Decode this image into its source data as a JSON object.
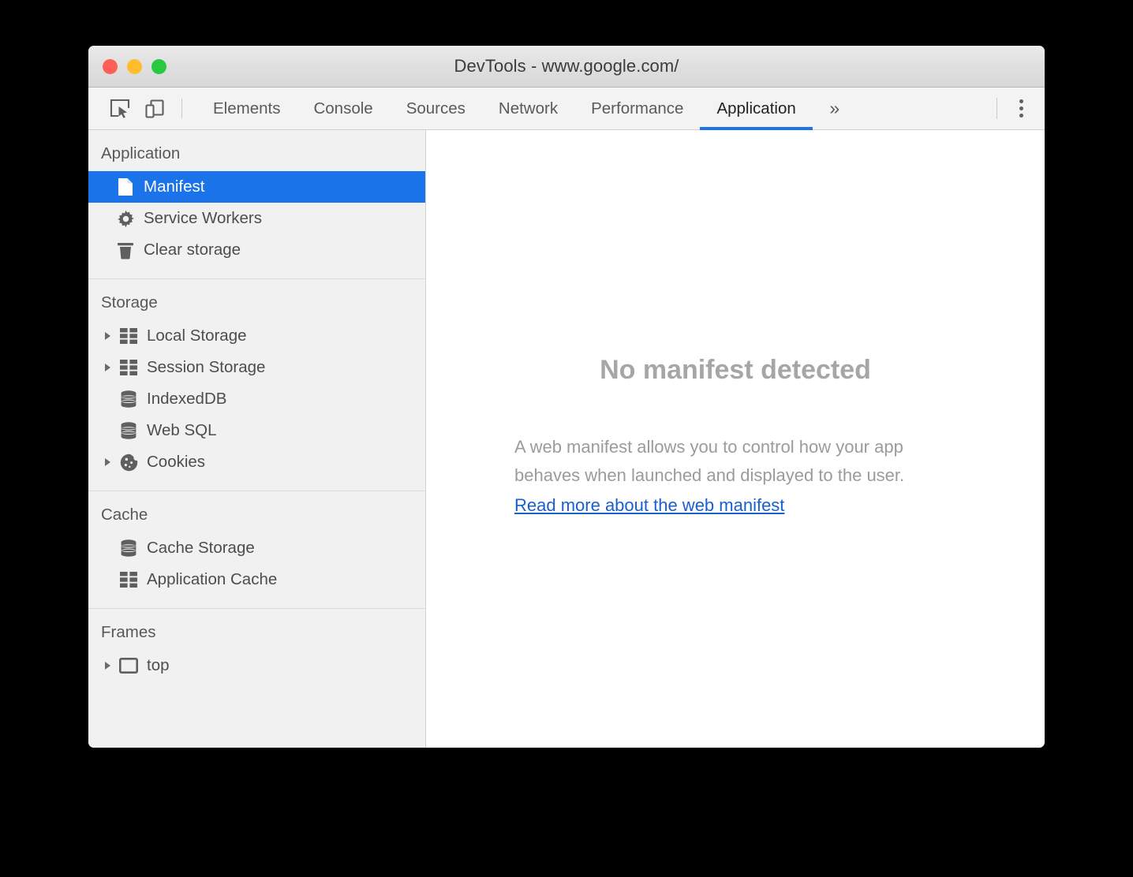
{
  "window": {
    "title": "DevTools - www.google.com/",
    "traffic_lights": [
      {
        "name": "close",
        "color": "#ff5f56"
      },
      {
        "name": "minimize",
        "color": "#ffbd2e"
      },
      {
        "name": "maximize",
        "color": "#27c93f"
      }
    ]
  },
  "toolbar": {
    "inspect_icon": "inspect-element-icon",
    "device_icon": "device-toolbar-icon",
    "overflow_label": "»",
    "menu_icon": "more-vertical-icon",
    "tabs": [
      {
        "label": "Elements",
        "active": false
      },
      {
        "label": "Console",
        "active": false
      },
      {
        "label": "Sources",
        "active": false
      },
      {
        "label": "Network",
        "active": false
      },
      {
        "label": "Performance",
        "active": false
      },
      {
        "label": "Application",
        "active": true
      }
    ],
    "active_tab": "Application",
    "accent_color": "#1a73e8"
  },
  "sidebar": {
    "sections": [
      {
        "title": "Application",
        "items": [
          {
            "label": "Manifest",
            "icon": "document-icon",
            "expandable": false,
            "selected": true
          },
          {
            "label": "Service Workers",
            "icon": "gear-icon",
            "expandable": false,
            "selected": false
          },
          {
            "label": "Clear storage",
            "icon": "trash-icon",
            "expandable": false,
            "selected": false
          }
        ]
      },
      {
        "title": "Storage",
        "items": [
          {
            "label": "Local Storage",
            "icon": "table-icon",
            "expandable": true,
            "selected": false
          },
          {
            "label": "Session Storage",
            "icon": "table-icon",
            "expandable": true,
            "selected": false
          },
          {
            "label": "IndexedDB",
            "icon": "database-icon",
            "expandable": false,
            "selected": false
          },
          {
            "label": "Web SQL",
            "icon": "database-icon",
            "expandable": false,
            "selected": false
          },
          {
            "label": "Cookies",
            "icon": "cookie-icon",
            "expandable": true,
            "selected": false
          }
        ]
      },
      {
        "title": "Cache",
        "items": [
          {
            "label": "Cache Storage",
            "icon": "database-icon",
            "expandable": false,
            "selected": false
          },
          {
            "label": "Application Cache",
            "icon": "table-icon",
            "expandable": false,
            "selected": false
          }
        ]
      },
      {
        "title": "Frames",
        "items": [
          {
            "label": "top",
            "icon": "frame-icon",
            "expandable": true,
            "selected": false
          }
        ]
      }
    ]
  },
  "main": {
    "empty_state": {
      "title": "No manifest detected",
      "description": "A web manifest allows you to control how your app behaves when launched and displayed to the user.",
      "link_text": "Read more about the web manifest",
      "link_color": "#1a5fd0"
    }
  }
}
